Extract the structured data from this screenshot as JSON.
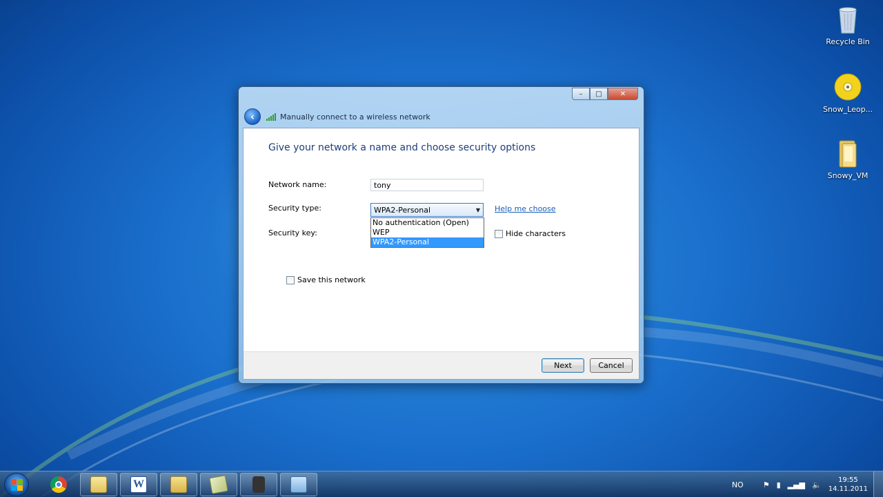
{
  "desktop": {
    "icons": [
      {
        "label": "Recycle Bin",
        "icon": "recycle-bin-icon"
      },
      {
        "label": "Snow_Leop...",
        "icon": "dvd-icon"
      },
      {
        "label": "Snowy_VM",
        "icon": "folder-icon"
      }
    ]
  },
  "window": {
    "title": "Manually connect to a wireless network",
    "controls": {
      "minimize": "–",
      "maximize": "□",
      "close": "✕"
    },
    "heading": "Give your network a name and choose security options",
    "network_name": {
      "label": "Network name:",
      "value": "tony"
    },
    "security_type": {
      "label": "Security type:",
      "selected": "WPA2-Personal",
      "options": [
        "No authentication (Open)",
        "WEP",
        "WPA2-Personal"
      ]
    },
    "help_link": "Help me choose",
    "security_key": {
      "label": "Security key:"
    },
    "hide_characters": {
      "label": "Hide characters",
      "checked": false
    },
    "save_network": {
      "label": "Save this network",
      "checked": false
    },
    "buttons": {
      "next": "Next",
      "cancel": "Cancel"
    }
  },
  "taskbar": {
    "pinned": [
      "explorer-icon",
      "chrome-icon",
      "libraries-icon",
      "word-icon",
      "folder-icon",
      "notes-icon",
      "camera-icon",
      "control-panel-icon"
    ],
    "tray": {
      "language": "NO",
      "time": "19:55",
      "date": "14.11.2011"
    }
  },
  "colors": {
    "accent": "#3399ff",
    "link": "#1a5fb4",
    "heading": "#1e3e7a"
  }
}
